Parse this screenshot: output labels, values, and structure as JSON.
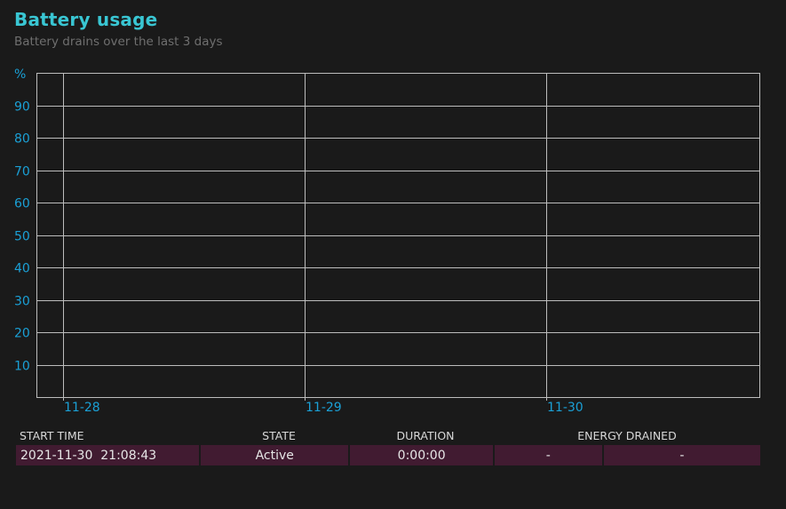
{
  "header": {
    "title": "Battery usage",
    "subtitle": "Battery drains over the last 3 days"
  },
  "chart_data": {
    "type": "line",
    "ylabel": "%",
    "ylim": [
      0,
      100
    ],
    "yticks": [
      10,
      20,
      30,
      40,
      50,
      60,
      70,
      80,
      90
    ],
    "xticks": [
      "11-28",
      "11-29",
      "11-30"
    ],
    "series": [],
    "grid": true
  },
  "table": {
    "headers": {
      "start_time": "START TIME",
      "state": "STATE",
      "duration": "DURATION",
      "energy_drained": "ENERGY DRAINED"
    },
    "rows": [
      {
        "start_time": "2021-11-30  21:08:43",
        "state": "Active",
        "duration": "0:00:00",
        "energy_percent": "-",
        "energy_mwh": "-"
      }
    ]
  },
  "colors": {
    "title": "#39c6d3",
    "axis_labels": "#1aa0d6",
    "row_background": "#411b31",
    "background": "#1a1a1a"
  }
}
